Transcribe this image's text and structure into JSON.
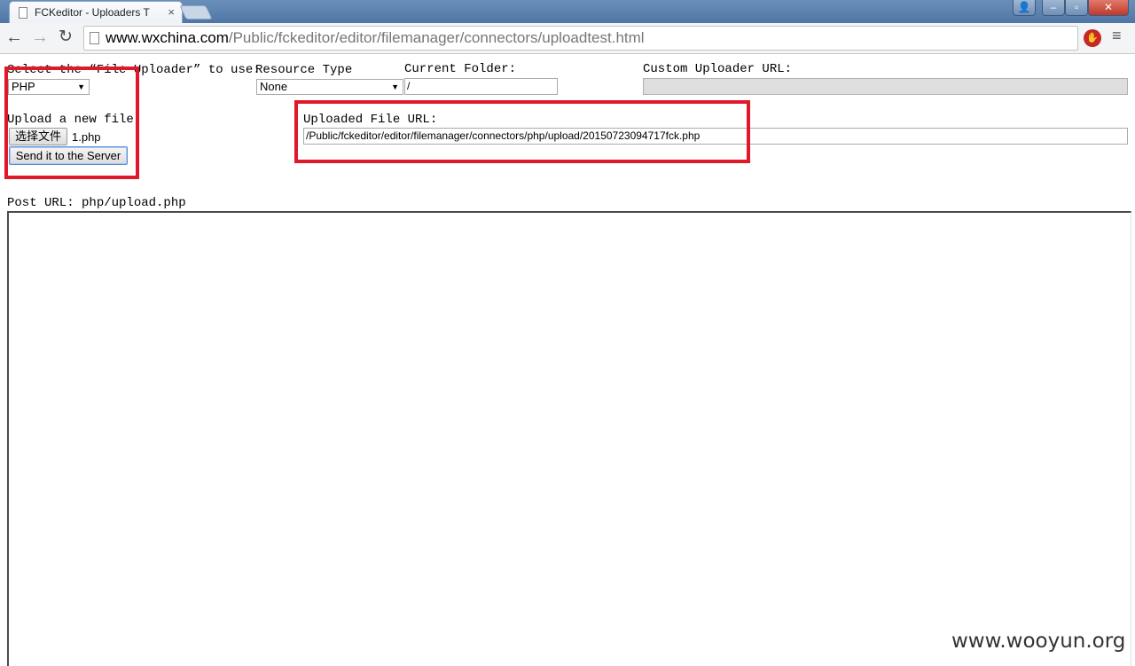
{
  "browser": {
    "tab_title": "FCKeditor - Uploaders T",
    "tab_close": "×",
    "url_host": "www.wxchina.com",
    "url_path": "/Public/fckeditor/editor/filemanager/connectors/uploadtest.html",
    "nav": {
      "back": "←",
      "forward": "→",
      "reload": "↻"
    },
    "star": "☆",
    "menu": "≡",
    "window_controls": {
      "user": "👤",
      "minimize": "–",
      "maximize": "▫",
      "close": "✕"
    }
  },
  "form": {
    "uploader_label": "Select the “File Uploader” to use:",
    "uploader_value": "PHP",
    "resource_type_label": "Resource Type",
    "resource_type_value": "None",
    "current_folder_label": "Current Folder:",
    "current_folder_value": "/",
    "custom_url_label": "Custom Uploader URL:",
    "custom_url_value": "",
    "upload_label": "Upload a new file:",
    "choose_file_button": "选择文件",
    "chosen_file": "1.php",
    "send_button": "Send it to the Server",
    "uploaded_url_label": "Uploaded File URL:",
    "uploaded_url_value": "/Public/fckeditor/editor/filemanager/connectors/php/upload/20150723094717fck.php",
    "post_url": "Post URL: php/upload.php"
  },
  "watermark": "www.wooyun.org",
  "colors": {
    "highlight": "#e0192a",
    "titlebar": "#5a80b0"
  }
}
